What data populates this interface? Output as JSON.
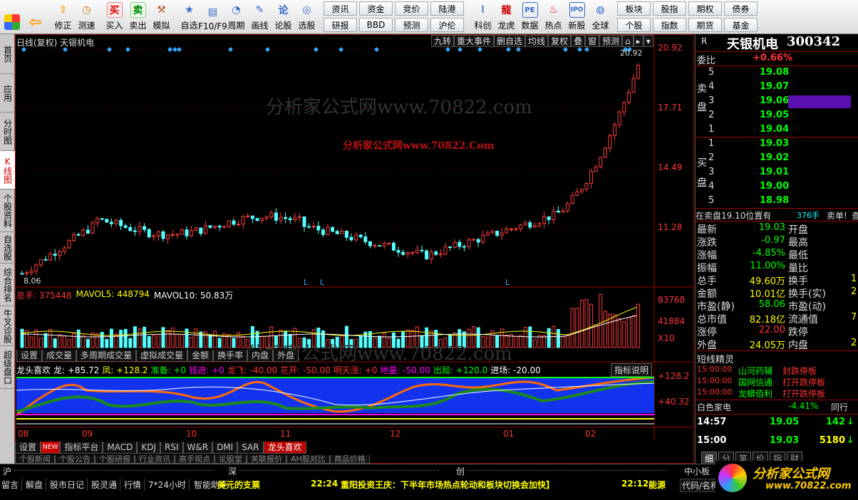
{
  "toolbar": {
    "left": [
      {
        "id": "b1",
        "label": "",
        "icon": "grid-icon"
      },
      {
        "id": "b2",
        "label": "",
        "icon": "back-arrow-icon"
      },
      {
        "id": "b3",
        "label": "修正",
        "icon": "up-arrow-icon"
      },
      {
        "id": "b4",
        "label": "测速",
        "icon": "stopwatch-icon"
      },
      {
        "id": "b5",
        "label": "买入",
        "icon": "buy-icon",
        "glyph": "买"
      },
      {
        "id": "b6",
        "label": "卖出",
        "icon": "sell-icon",
        "glyph": "卖"
      },
      {
        "id": "b7",
        "label": "模拟",
        "icon": "gavel-icon"
      },
      {
        "id": "b8",
        "label": "自选",
        "icon": "star-icon"
      },
      {
        "id": "b9",
        "label": "F10/F9",
        "icon": "f10-icon"
      },
      {
        "id": "b10",
        "label": "周期",
        "icon": "cycle-icon"
      },
      {
        "id": "b11",
        "label": "画线",
        "icon": "pencil-icon"
      },
      {
        "id": "b12",
        "label": "论股",
        "icon": "discuss-icon",
        "glyph": "论"
      },
      {
        "id": "b13",
        "label": "选股",
        "icon": "select-icon"
      }
    ],
    "group1": [
      [
        "资讯",
        "资金",
        "竞价",
        "陆港"
      ],
      [
        "研报",
        "BBD",
        "预测",
        "沪伦"
      ]
    ],
    "right": [
      {
        "id": "r1",
        "label": "科创",
        "icon": "chart-icon"
      },
      {
        "id": "r2",
        "label": "龙虎",
        "icon": "dragon-icon"
      },
      {
        "id": "r3",
        "label": "数据",
        "icon": "pe-icon",
        "glyph": "PE"
      },
      {
        "id": "r4",
        "label": "热点",
        "icon": "hot-icon"
      },
      {
        "id": "r5",
        "label": "新股",
        "icon": "ipo-icon",
        "glyph": "IPO"
      },
      {
        "id": "r6",
        "label": "全球",
        "icon": "globe-icon"
      }
    ],
    "group2": [
      [
        "板块",
        "股指",
        "期权",
        "债券"
      ],
      [
        "个股",
        "指数",
        "期货",
        "基金"
      ]
    ]
  },
  "leftnav": [
    "首页",
    "应用",
    "分时图",
    "K线图",
    "个股资料",
    "自选股",
    "综合排名",
    "牛叉诊股",
    "超级盘口"
  ],
  "chart": {
    "title": "日线(复权) 天银机电",
    "toolbar": [
      "九转",
      "重大事件",
      "删自选",
      "均线",
      "复权",
      "叠",
      "窗",
      "预测"
    ],
    "price_axis": [
      "20.92",
      "17.71",
      "14.49",
      "11.28"
    ],
    "high_label": "20.92",
    "low_label": "8.06",
    "watermark1": "分析家公式网www.70822.com",
    "watermark2": "分析家公式网www.70822.Com",
    "volume": {
      "label": "总手: 375448",
      "mavol5": "MAVOL5: 448794",
      "mavol10": "MAVOL10: 50.83万",
      "axis": [
        "83768",
        "41884",
        "X10"
      ]
    },
    "vol_tabs": [
      "设置",
      "成交量",
      "多周期成交量",
      "虚拟成交量",
      "金额",
      "换手率",
      "内盘",
      "外盘"
    ],
    "indicator": {
      "name": "龙头喜欢",
      "values": [
        [
          "龙: +85.72",
          "#ffffff"
        ],
        [
          "凤: +128.2",
          "#ffff00"
        ],
        [
          "准备: +0",
          "#00ff00"
        ],
        [
          "钱进: +0",
          "#ff00ff"
        ],
        [
          "龙飞: -40.00",
          "#ff3030"
        ],
        [
          "花开: -50.00",
          "#ff3030"
        ],
        [
          "明天涨: +0",
          "#ff3030"
        ],
        [
          "地量: -50.00",
          "#ff00ff"
        ],
        [
          "出局: +120.0",
          "#00ff00"
        ],
        [
          "进场: -20.00",
          "#ffffff"
        ]
      ],
      "help": "指标说明",
      "axis": [
        "+128.2",
        "+40.32"
      ]
    },
    "months": [
      "08",
      "09",
      "10",
      "11",
      "12",
      "01",
      "02"
    ],
    "ind_tabs": [
      "设置",
      "指标平台",
      "MACD",
      "KDJ",
      "RSI",
      "W&R",
      "DMI",
      "SAR",
      "龙头喜欢"
    ],
    "new_badge": "NEW",
    "info_tabs": [
      "个股新闻",
      "个股公告",
      "个股研报",
      "行业资讯",
      "高手观点",
      "论股堂",
      "关联报价",
      "AH股对比",
      "商品价格"
    ]
  },
  "right": {
    "code_label": "R",
    "name": "天银机电",
    "code": "300342",
    "weibi_label": "委比",
    "weibi": "+0.66%",
    "sell_label": "卖盘",
    "buy_label": "买盘",
    "sell": [
      [
        "5",
        "19.08"
      ],
      [
        "4",
        "19.07"
      ],
      [
        "3",
        "19.06"
      ],
      [
        "2",
        "19.05"
      ],
      [
        "1",
        "19.04"
      ]
    ],
    "buy": [
      [
        "1",
        "19.03"
      ],
      [
        "2",
        "19.02"
      ],
      [
        "3",
        "19.01"
      ],
      [
        "4",
        "19.00"
      ],
      [
        "5",
        "18.98"
      ]
    ],
    "notice": "在卖盘19.10位置有",
    "notice_qty": "376手",
    "notice_act": "卖单!",
    "notice_search": "查",
    "quote": [
      [
        "最新",
        "19.03",
        "开盘",
        ""
      ],
      [
        "涨跌",
        "-0.97",
        "最高",
        ""
      ],
      [
        "涨幅",
        "-4.85%",
        "最低",
        ""
      ],
      [
        "振幅",
        "11.00%",
        "量比",
        ""
      ],
      [
        "总手",
        "49.60万",
        "换手",
        "1"
      ],
      [
        "金额",
        "10.01亿",
        "换手(实)",
        "2"
      ],
      [
        "市盈(静)",
        "58.06",
        "市盈(动)",
        ""
      ],
      [
        "总市值",
        "82.18亿",
        "流通值",
        "7"
      ],
      [
        "涨停",
        "22.00",
        "跌停",
        ""
      ],
      [
        "外盘",
        "24.05万",
        "内盘",
        "2"
      ]
    ],
    "short_title": "短线精灵",
    "short": [
      [
        "15:00:00",
        "山河药辅",
        "封跌停板"
      ],
      [
        "15:00:00",
        "国网信通",
        "打开跌停板"
      ],
      [
        "15:00:00",
        "龙蟒佰利",
        "打开跌停板"
      ]
    ],
    "sector": "白色家电",
    "sector_chg": "-4.41%",
    "sector_tab": "同行",
    "ticks": [
      [
        "14:57",
        "19.05",
        "142"
      ],
      [
        "15:00",
        "19.03",
        "5180"
      ]
    ],
    "bottom_tabs": [
      "细",
      "分",
      "笔",
      "价",
      "指",
      "财"
    ]
  },
  "status": {
    "markets": [
      "沪",
      "深",
      "创"
    ],
    "board": "中小板",
    "items": [
      "留言",
      "解盘",
      "股市日记",
      "股灵通",
      "行情",
      "7*24小时",
      "智能助手"
    ],
    "topic": "美元的支票",
    "news_time": "22:24",
    "news": "重阳投资王庆：下半年市场热点轮动和板块切换会加快】",
    "time2": "22:12",
    "extra": "能源",
    "code_search": "代码/名称/简",
    "logo": "分析家公式网",
    "logo_url": "www.70822.com"
  }
}
